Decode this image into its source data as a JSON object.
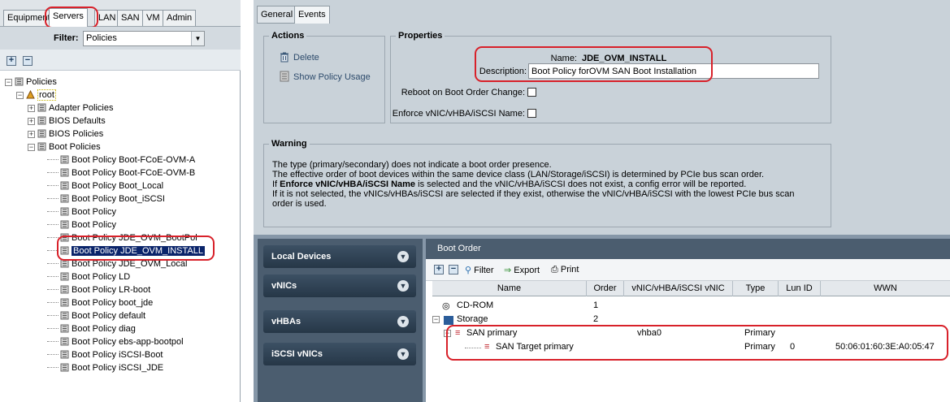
{
  "nav_tabs": [
    "Equipment",
    "Servers",
    "LAN",
    "SAN",
    "VM",
    "Admin"
  ],
  "filter": {
    "label": "Filter:",
    "value": "Policies"
  },
  "tree": {
    "policies": "Policies",
    "root": "root",
    "adapter": "Adapter Policies",
    "bios_defaults": "BIOS Defaults",
    "bios_policies": "BIOS Policies",
    "boot_policies": "Boot Policies",
    "boot_items": [
      "Boot Policy Boot-FCoE-OVM-A",
      "Boot Policy Boot-FCoE-OVM-B",
      "Boot Policy Boot_Local",
      "Boot Policy Boot_iSCSI",
      "Boot Policy",
      "Boot Policy",
      "Boot Policy JDE_OVM_BootPol",
      "Boot Policy JDE_OVM_INSTALL",
      "Boot Policy JDE_OVM_Local",
      "Boot Policy LD",
      "Boot Policy LR-boot",
      "Boot Policy boot_jde",
      "Boot Policy default",
      "Boot Policy diag",
      "Boot Policy ebs-app-bootpol",
      "Boot Policy iSCSI-Boot",
      "Boot Policy iSCSI_JDE"
    ]
  },
  "right_tabs": [
    "General",
    "Events"
  ],
  "actions": {
    "title": "Actions",
    "delete": "Delete",
    "show_usage": "Show Policy Usage"
  },
  "properties": {
    "title": "Properties",
    "name_label": "Name:",
    "name_value": "JDE_OVM_INSTALL",
    "desc_label": "Description:",
    "desc_value": "Boot Policy forOVM SAN Boot Installation",
    "reboot_label": "Reboot on Boot Order Change:",
    "enforce_label": "Enforce vNIC/vHBA/iSCSI Name:"
  },
  "warning": {
    "title": "Warning",
    "line1": "The type (primary/secondary) does not indicate a boot order presence.",
    "line2": "The effective order of boot devices within the same device class (LAN/Storage/iSCSI) is determined by PCIe bus scan order.",
    "line3_prefix": "If ",
    "line3_bold": "Enforce vNIC/vHBA/iSCSI Name",
    "line3_suffix": " is selected and the vNIC/vHBA/iSCSI does not exist, a config error will be reported.",
    "line4": "If it is not selected, the vNICs/vHBAs/iSCSI are selected if they exist, otherwise the vNIC/vHBA/iSCSI with the lowest PCIe bus scan",
    "line5": "order is used."
  },
  "devices": [
    "Local Devices",
    "vNICs",
    "vHBAs",
    "iSCSI vNICs"
  ],
  "boot_order": {
    "title": "Boot Order",
    "toolbar": {
      "filter": "Filter",
      "export": "Export",
      "print": "Print"
    },
    "columns": [
      "Name",
      "Order",
      "vNIC/vHBA/iSCSI vNIC",
      "Type",
      "Lun ID",
      "WWN"
    ],
    "rows": [
      {
        "name": "CD-ROM",
        "order": "1",
        "vnic": "",
        "type": "",
        "lun": "",
        "wwn": ""
      },
      {
        "name": "Storage",
        "order": "2",
        "vnic": "",
        "type": "",
        "lun": "",
        "wwn": ""
      },
      {
        "name": "SAN primary",
        "order": "",
        "vnic": "vhba0",
        "type": "Primary",
        "lun": "",
        "wwn": ""
      },
      {
        "name": "SAN Target primary",
        "order": "",
        "vnic": "",
        "type": "Primary",
        "lun": "0",
        "wwn": "50:06:01:60:3E:A0:05:47"
      }
    ]
  },
  "colors": {
    "highlight": "#d8212a",
    "selection": "#0a246a",
    "panel": "#c9d2d9",
    "device_bar": "#4b5d6f"
  }
}
